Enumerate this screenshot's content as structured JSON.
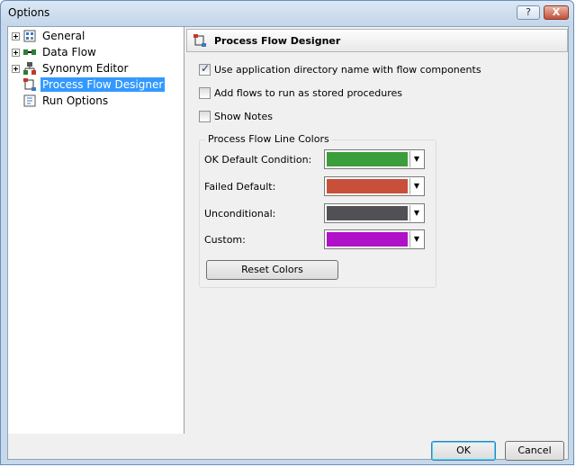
{
  "window": {
    "title": "Options",
    "help_label": "?",
    "close_label": "X"
  },
  "tree": {
    "items": [
      {
        "label": "General",
        "expandable": true
      },
      {
        "label": "Data Flow",
        "expandable": true
      },
      {
        "label": "Synonym Editor",
        "expandable": true
      },
      {
        "label": "Process Flow Designer",
        "expandable": false,
        "selected": true
      },
      {
        "label": "Run Options",
        "expandable": false
      }
    ]
  },
  "panel": {
    "title": "Process Flow Designer",
    "checkboxes": [
      {
        "label": "Use application directory name with flow components",
        "checked": true
      },
      {
        "label": "Add flows to run as stored procedures",
        "checked": false
      },
      {
        "label": "Show Notes",
        "checked": false
      }
    ],
    "group": {
      "title": "Process Flow Line Colors",
      "rows": [
        {
          "label": "OK Default Condition:",
          "color": "#3a9e3a"
        },
        {
          "label": "Failed Default:",
          "color": "#c8503a"
        },
        {
          "label": "Unconditional:",
          "color": "#505055"
        },
        {
          "label": "Custom:",
          "color": "#b010c8"
        }
      ],
      "reset_label": "Reset Colors"
    }
  },
  "footer": {
    "ok_label": "OK",
    "cancel_label": "Cancel"
  }
}
